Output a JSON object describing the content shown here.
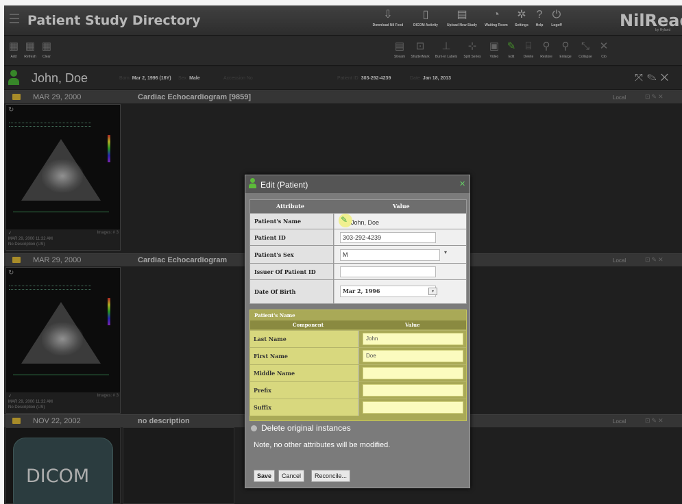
{
  "app": {
    "title": "Patient Study Directory",
    "brand": "NilRead",
    "brand_sub": "by Hyland"
  },
  "topnav": [
    {
      "label": "Download Nil Feed",
      "icon": "download-icon"
    },
    {
      "label": "DICOM Activity",
      "icon": "activity-icon"
    },
    {
      "label": "Upload New Study",
      "icon": "upload-icon"
    },
    {
      "label": "Waiting Room",
      "icon": "waiting-room-icon"
    },
    {
      "label": "Settings",
      "icon": "gear-icon"
    },
    {
      "label": "Help",
      "icon": "help-icon"
    },
    {
      "label": "Logoff",
      "icon": "power-icon"
    }
  ],
  "toolbar_left": [
    {
      "label": "Add",
      "icon": "add-icon"
    },
    {
      "label": "Refresh",
      "icon": "refresh-icon"
    },
    {
      "label": "Clear",
      "icon": "clear-icon"
    }
  ],
  "toolbar_right": [
    {
      "label": "Stream",
      "icon": "stream-icon"
    },
    {
      "label": "ShutterMark",
      "icon": "shutter-icon"
    },
    {
      "label": "Burn-in Labels",
      "icon": "label-icon"
    },
    {
      "label": "Split Series",
      "icon": "split-icon"
    },
    {
      "label": "Video",
      "icon": "video-icon"
    },
    {
      "label": "Edit",
      "icon": "pencil-icon"
    },
    {
      "label": "Delete",
      "icon": "trash-icon"
    },
    {
      "label": "Restore",
      "icon": "restore-icon"
    },
    {
      "label": "Enlarge",
      "icon": "zoom-in-icon"
    },
    {
      "label": "Collapse",
      "icon": "collapse-icon"
    },
    {
      "label": "Clo",
      "icon": "close-icon"
    }
  ],
  "patient": {
    "name": "John, Doe",
    "born_label": "Born",
    "born": "Mar 2, 1996  (16Y)",
    "sex_label": "Sex",
    "sex": "Male",
    "accession_label": "Accession No",
    "patient_id_label": "Patient ID",
    "patient_id": "303-292-4239",
    "date_label": "Date",
    "date": "Jan 18, 2013"
  },
  "studies": [
    {
      "date": "MAR 29, 2000",
      "description": "Cardiac Echocardiogram [9859]",
      "location": "Local",
      "thumb": {
        "series": "Images: # 3",
        "datetime": "MAR 29, 2000 11:32 AM",
        "desc": "No Description (US)"
      }
    },
    {
      "date": "MAR 29, 2000",
      "description": "Cardiac Echocardiogram",
      "location": "Local",
      "thumb": {
        "series": "Images: # 3",
        "datetime": "MAR 29, 2000 11:32 AM",
        "desc": "No Description (US)"
      }
    },
    {
      "date": "NOV 22, 2002",
      "description": "no description",
      "location": "Local",
      "thumb": {
        "label": "DICOM"
      }
    }
  ],
  "dialog": {
    "title": "Edit (Patient)",
    "columns": {
      "attribute": "Attribute",
      "value": "Value"
    },
    "rows": [
      {
        "label": "Patient's Name",
        "value": "John, Doe"
      },
      {
        "label": "Patient ID",
        "value": "303-292-4239"
      },
      {
        "label": "Patient's Sex",
        "value": "M"
      },
      {
        "label": "Issuer Of Patient ID",
        "value": ""
      },
      {
        "label": "Date Of Birth",
        "value": "Mar 2, 1996"
      }
    ],
    "name_panel": {
      "title": "Patient's Name",
      "columns": {
        "component": "Component",
        "value": "Value"
      },
      "rows": [
        {
          "label": "Last Name",
          "value": "John"
        },
        {
          "label": "First Name",
          "value": "Doe"
        },
        {
          "label": "Middle Name",
          "value": ""
        },
        {
          "label": "Prefix",
          "value": ""
        },
        {
          "label": "Suffix",
          "value": ""
        }
      ]
    },
    "delete_label": "Delete original instances",
    "note": "Note, no other attributes will be modified.",
    "buttons": {
      "save": "Save",
      "cancel": "Cancel",
      "reconcile": "Reconcile..."
    }
  }
}
